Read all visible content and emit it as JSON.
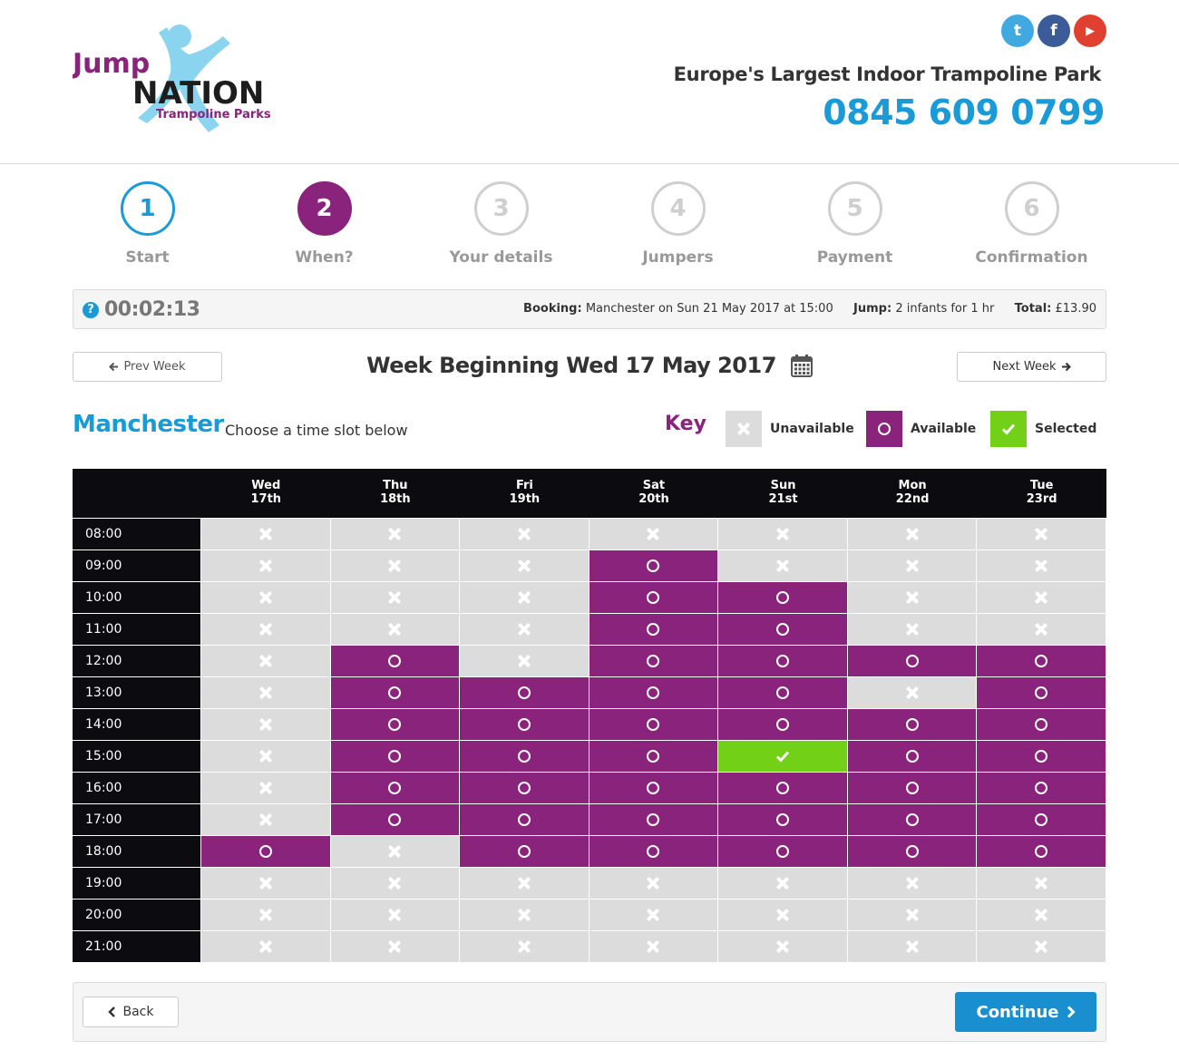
{
  "header": {
    "logo": {
      "word1": "Jump",
      "word2": "NATION",
      "word3": "Trampoline Parks"
    },
    "social": [
      {
        "name": "twitter-icon",
        "glyph": "t",
        "color": "#3fa9e0"
      },
      {
        "name": "facebook-icon",
        "glyph": "f",
        "color": "#3b5b99"
      },
      {
        "name": "youtube-icon",
        "glyph": "▶",
        "color": "#e0402f"
      }
    ],
    "tagline": "Europe's Largest Indoor Trampoline Park",
    "phone": "0845 609 0799"
  },
  "steps": [
    {
      "number": "1",
      "label": "Start",
      "state": "done"
    },
    {
      "number": "2",
      "label": "When?",
      "state": "active"
    },
    {
      "number": "3",
      "label": "Your details",
      "state": "todo"
    },
    {
      "number": "4",
      "label": "Jumpers",
      "state": "todo"
    },
    {
      "number": "5",
      "label": "Payment",
      "state": "todo"
    },
    {
      "number": "6",
      "label": "Confirmation",
      "state": "todo"
    }
  ],
  "summary": {
    "help": "?",
    "timer": "00:02:13",
    "booking_label": "Booking:",
    "booking_value": "Manchester on Sun 21 May 2017 at 15:00",
    "jump_label": "Jump:",
    "jump_value": "2 infants for 1 hr",
    "total_label": "Total:",
    "total_value": "£13.90"
  },
  "week_nav": {
    "prev_label": "Prev Week",
    "next_label": "Next Week",
    "title": "Week Beginning Wed 17 May 2017"
  },
  "location": {
    "name": "Manchester",
    "instruction": "Choose a time slot below"
  },
  "key": {
    "title": "Key",
    "items": [
      {
        "label": "Unavailable",
        "state": "u"
      },
      {
        "label": "Available",
        "state": "a"
      },
      {
        "label": "Selected",
        "state": "s"
      }
    ]
  },
  "colors": {
    "brand_blue": "#1a9ad6",
    "brand_purple": "#8a237c",
    "selected_green": "#72d116",
    "unavailable_grey": "#dcdcdc"
  },
  "schedule": {
    "days": [
      {
        "day": "Wed",
        "date": "17th"
      },
      {
        "day": "Thu",
        "date": "18th"
      },
      {
        "day": "Fri",
        "date": "19th"
      },
      {
        "day": "Sat",
        "date": "20th"
      },
      {
        "day": "Sun",
        "date": "21st"
      },
      {
        "day": "Mon",
        "date": "22nd"
      },
      {
        "day": "Tue",
        "date": "23rd"
      }
    ],
    "rows": [
      {
        "time": "08:00",
        "slots": [
          "u",
          "u",
          "u",
          "u",
          "u",
          "u",
          "u"
        ]
      },
      {
        "time": "09:00",
        "slots": [
          "u",
          "u",
          "u",
          "a",
          "u",
          "u",
          "u"
        ]
      },
      {
        "time": "10:00",
        "slots": [
          "u",
          "u",
          "u",
          "a",
          "a",
          "u",
          "u"
        ]
      },
      {
        "time": "11:00",
        "slots": [
          "u",
          "u",
          "u",
          "a",
          "a",
          "u",
          "u"
        ]
      },
      {
        "time": "12:00",
        "slots": [
          "u",
          "a",
          "u",
          "a",
          "a",
          "a",
          "a"
        ]
      },
      {
        "time": "13:00",
        "slots": [
          "u",
          "a",
          "a",
          "a",
          "a",
          "u",
          "a"
        ]
      },
      {
        "time": "14:00",
        "slots": [
          "u",
          "a",
          "a",
          "a",
          "a",
          "a",
          "a"
        ]
      },
      {
        "time": "15:00",
        "slots": [
          "u",
          "a",
          "a",
          "a",
          "s",
          "a",
          "a"
        ]
      },
      {
        "time": "16:00",
        "slots": [
          "u",
          "a",
          "a",
          "a",
          "a",
          "a",
          "a"
        ]
      },
      {
        "time": "17:00",
        "slots": [
          "u",
          "a",
          "a",
          "a",
          "a",
          "a",
          "a"
        ]
      },
      {
        "time": "18:00",
        "slots": [
          "a",
          "u",
          "a",
          "a",
          "a",
          "a",
          "a"
        ]
      },
      {
        "time": "19:00",
        "slots": [
          "u",
          "u",
          "u",
          "u",
          "u",
          "u",
          "u"
        ]
      },
      {
        "time": "20:00",
        "slots": [
          "u",
          "u",
          "u",
          "u",
          "u",
          "u",
          "u"
        ]
      },
      {
        "time": "21:00",
        "slots": [
          "u",
          "u",
          "u",
          "u",
          "u",
          "u",
          "u"
        ]
      }
    ]
  },
  "footer": {
    "back_label": "Back",
    "continue_label": "Continue"
  }
}
